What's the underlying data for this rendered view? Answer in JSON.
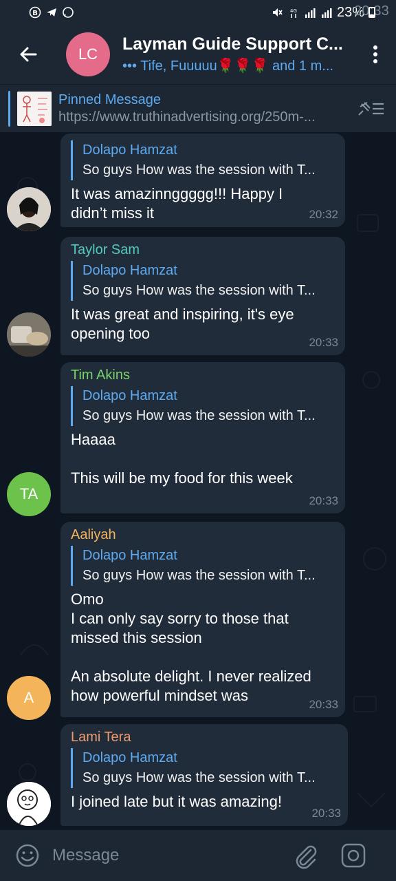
{
  "status_bar": {
    "time": "20:33",
    "battery": "23%"
  },
  "header": {
    "avatar_initials": "LC",
    "title": "Layman Guide Support C...",
    "subtitle": "••• Tife, Fuuuuu🌹🌹🌹 and 1 m..."
  },
  "pinned": {
    "title": "Pinned Message",
    "url": "https://www.truthinadvertising.org/250m-..."
  },
  "messages": [
    {
      "sender": "",
      "sender_color": "#5eaaf0",
      "reply_name": "Dolapo Hamzat",
      "reply_text": "So guys  How was the session with T...",
      "text": "It was amazinnggggg!!! Happy I\ndidn’t miss it",
      "time": "20:32",
      "avatar_initials": ""
    },
    {
      "sender": "Taylor Sam",
      "sender_color": "#54c9c0",
      "reply_name": "Dolapo Hamzat",
      "reply_text": "So guys  How was the session with T...",
      "text": "It was great and inspiring,  it's eye\nopening too",
      "time": "20:33",
      "avatar_initials": ""
    },
    {
      "sender": "Tim Akins",
      "sender_color": "#7bd36a",
      "reply_name": "Dolapo Hamzat",
      "reply_text": "So guys  How was the session with T...",
      "text": "Haaaa\n\nThis will be my food for this week",
      "time": "20:33",
      "avatar_initials": "TA"
    },
    {
      "sender": "Aaliyah",
      "sender_color": "#f3b45a",
      "reply_name": "Dolapo Hamzat",
      "reply_text": "So guys  How was the session with T...",
      "text": "Omo\nI can only say sorry to those that\nmissed this session\n\nAn absolute delight. I never realized\nhow powerful mindset was",
      "time": "20:33",
      "avatar_initials": "A"
    },
    {
      "sender": "Lami Tera",
      "sender_color": "#f09a6e",
      "reply_name": "Dolapo Hamzat",
      "reply_text": "So guys  How was the session with T...",
      "text": "I joined late but it was amazing!",
      "time": "20:33",
      "avatar_initials": ""
    }
  ],
  "input": {
    "placeholder": "Message"
  },
  "colors": {
    "accent": "#5eaaf0",
    "header_bg": "#1d2733",
    "chat_bg": "#0e1621",
    "bubble_bg": "#212c3a",
    "avatar_lc": "#e56b8b",
    "avatar_ta": "#6cc24a",
    "avatar_a": "#f3b45a"
  }
}
